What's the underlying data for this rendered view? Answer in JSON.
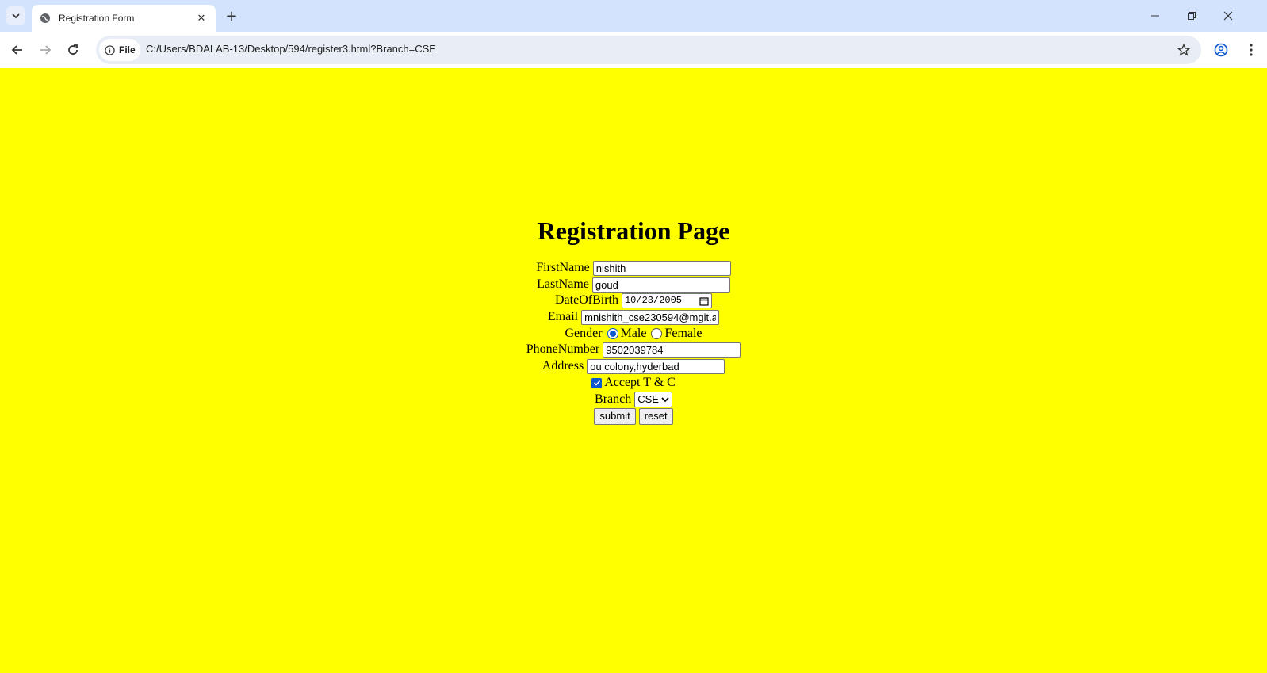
{
  "browser": {
    "tab_title": "Registration Form",
    "site_chip": "File",
    "url": "C:/Users/BDALAB-13/Desktop/594/register3.html?Branch=CSE"
  },
  "page": {
    "heading": "Registration Page",
    "background_color": "#ffff00"
  },
  "form": {
    "firstname_label": "FirstName",
    "firstname_value": "nishith",
    "lastname_label": "LastName",
    "lastname_value": "goud",
    "dob_label": "DateOfBirth",
    "dob_value": "10/23/2005",
    "email_label": "Email",
    "email_value": "mnishith_cse230594@mgit.a",
    "gender_label": "Gender",
    "gender_options": [
      "Male",
      "Female"
    ],
    "gender_selected": "Male",
    "phone_label": "PhoneNumber",
    "phone_value": "9502039784",
    "address_label": "Address",
    "address_value": "ou colony,hyderbad",
    "terms_label": "Accept T & C",
    "terms_checked": true,
    "branch_label": "Branch",
    "branch_value": "CSE",
    "submit_label": "submit",
    "reset_label": "reset"
  }
}
